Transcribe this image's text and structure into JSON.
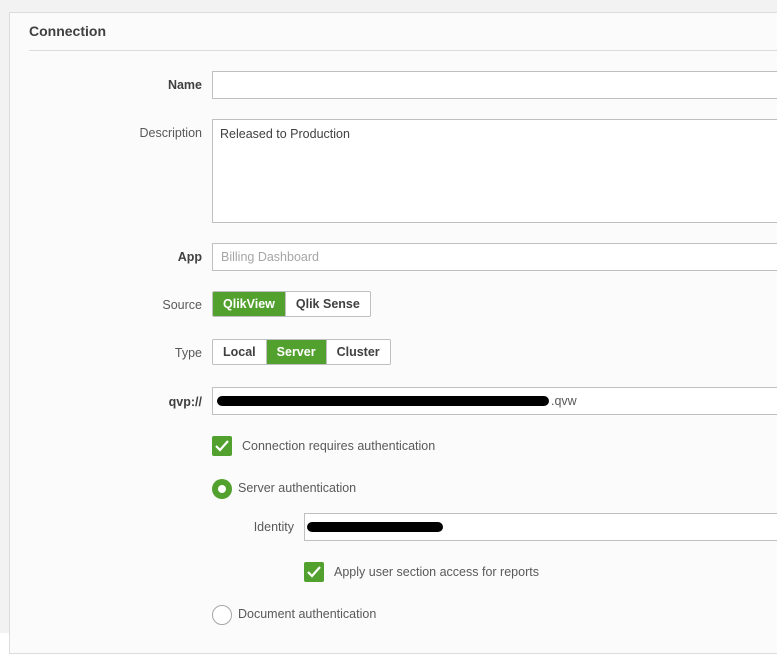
{
  "panel": {
    "title": "Connection"
  },
  "form": {
    "name": {
      "label": "Name",
      "value": ""
    },
    "description": {
      "label": "Description",
      "value": "Released to Production"
    },
    "app": {
      "label": "App",
      "placeholder": "Billing Dashboard"
    },
    "source": {
      "label": "Source",
      "options": [
        "QlikView",
        "Qlik Sense"
      ],
      "selected": "QlikView"
    },
    "type": {
      "label": "Type",
      "options": [
        "Local",
        "Server",
        "Cluster"
      ],
      "selected": "Server"
    },
    "qvp": {
      "label": "qvp://",
      "value_suffix": ".qvw"
    },
    "requires_auth": {
      "label": "Connection requires authentication",
      "checked": true
    },
    "server_auth": {
      "label": "Server authentication",
      "selected": true
    },
    "identity": {
      "label": "Identity"
    },
    "section_access": {
      "label": "Apply user section access for reports",
      "checked": true
    },
    "document_auth": {
      "label": "Document authentication",
      "selected": false
    }
  },
  "colors": {
    "accent": "#52a02e"
  }
}
